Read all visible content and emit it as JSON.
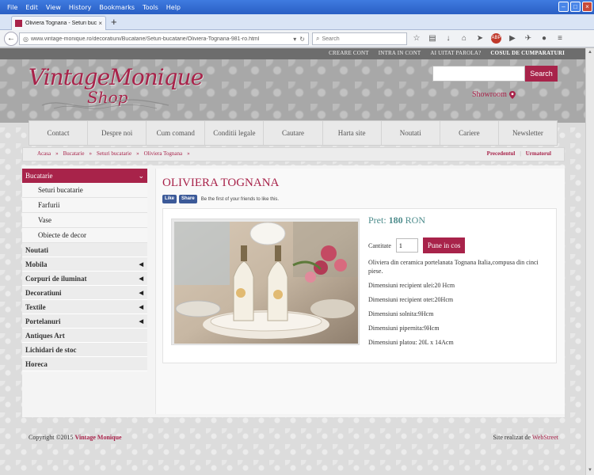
{
  "browser": {
    "menu": [
      "File",
      "Edit",
      "View",
      "History",
      "Bookmarks",
      "Tools",
      "Help"
    ],
    "tab_title": "Oliviera Tognana - Seturi buc...",
    "tab_close": "×",
    "new_tab": "+",
    "url": "www.vintage-monique.ro/decoratiuni/Bucatarie/Seturi-bucatarie/Oliviera-Tognana-981-ro.html",
    "search_placeholder": "Search"
  },
  "toplinks": {
    "create_account": "CREARE CONT",
    "login": "INTRA IN CONT",
    "forgot": "AI UITAT PAROLA?",
    "cart": "COSUL DE CUMPARATURI"
  },
  "header": {
    "logo_line1": "VintageMonique",
    "logo_line2": "Shop",
    "search_button": "Search",
    "showroom": "Showroom"
  },
  "nav": [
    "Contact",
    "Despre noi",
    "Cum comand",
    "Conditii legale",
    "Cautare",
    "Harta site",
    "Noutati",
    "Cariere",
    "Newsletter"
  ],
  "breadcrumb": [
    "Acasa",
    "Bucatarie",
    "Seturi bucatarie",
    "Oliviera Tognana"
  ],
  "breadcrumb_sep": "»",
  "pager": {
    "prev": "Precedentul",
    "sep": "|",
    "next": "Urmatorul"
  },
  "sidebar": {
    "active": "Bucatarie",
    "subitems": [
      "Seturi bucatarie",
      "Farfurii",
      "Vase",
      "Obiecte de decor"
    ],
    "categories": [
      {
        "label": "Noutati",
        "arrow": false
      },
      {
        "label": "Mobila",
        "arrow": true
      },
      {
        "label": "Corpuri de iluminat",
        "arrow": true
      },
      {
        "label": "Decoratiuni",
        "arrow": true
      },
      {
        "label": "Textile",
        "arrow": true
      },
      {
        "label": "Portelanuri",
        "arrow": true
      },
      {
        "label": "Antiques Art",
        "arrow": false
      },
      {
        "label": "Lichidari de stoc",
        "arrow": false
      },
      {
        "label": "Horeca",
        "arrow": false
      }
    ]
  },
  "product": {
    "title": "OLIVIERA TOGNANA",
    "fb_like": "Like",
    "fb_share": "Share",
    "social_text": "Be the first of your friends to like this.",
    "price_label": "Pret:",
    "price_value": "180",
    "price_currency": "RON",
    "qty_label": "Cantitate",
    "qty_value": "1",
    "add_to_cart": "Pune in cos",
    "description": [
      "Oliviera din ceramica portelanata Tognana Italia,compusa din cinci piese.",
      "Dimensiuni recipient ulei:20 Hcm",
      "Dimensiuni recipient otet:20Hcm",
      "Dimensiuni solnita:9Hcm",
      "Dimensiuni pipernita:9Hcm",
      "Dimensiuni platou: 20L x 14Acm"
    ]
  },
  "footer": {
    "copyright": "Copyright ©2015",
    "brand": "Vintage Monique",
    "made_by": "Site realizat de",
    "agency": "WebStreet"
  },
  "colors": {
    "brand": "#a8234a",
    "price": "#4d8c8c",
    "topbar": "#6d6d6d"
  }
}
